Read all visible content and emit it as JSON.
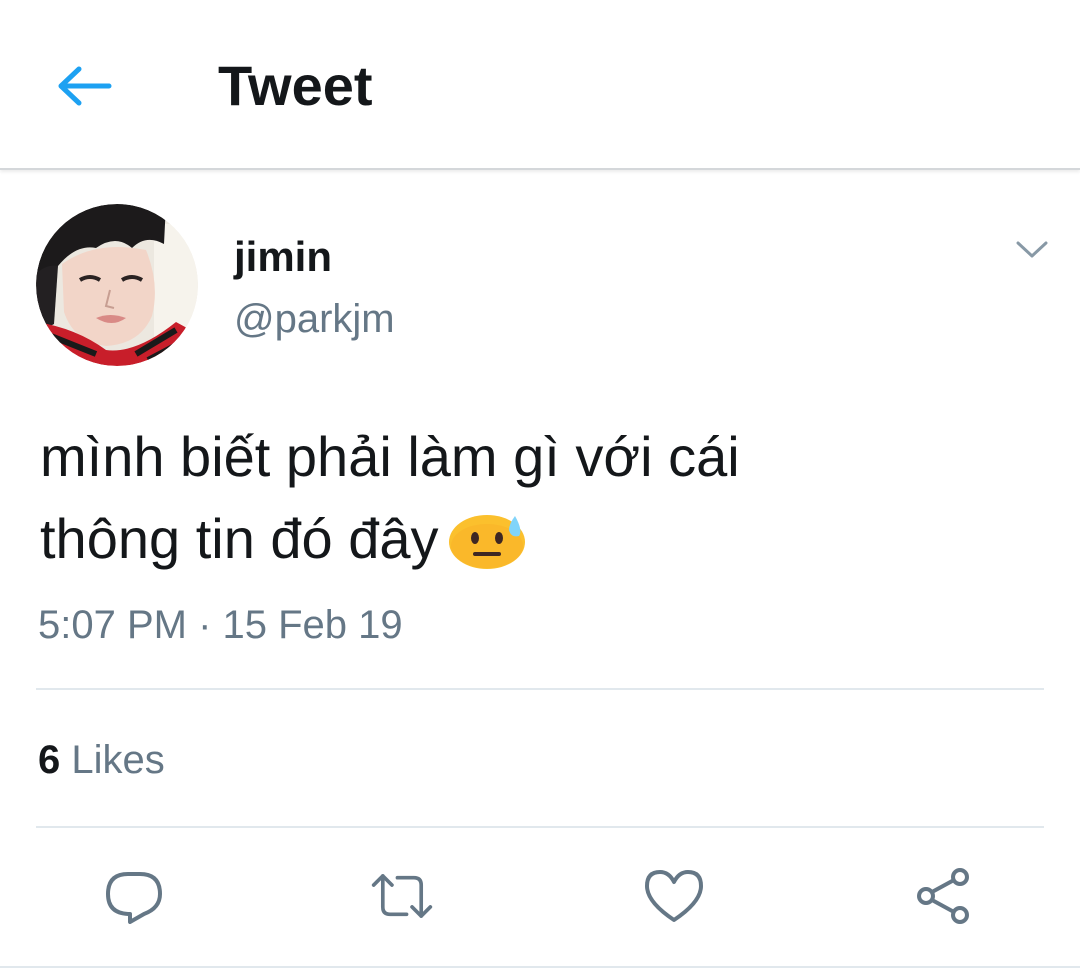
{
  "header": {
    "title": "Tweet",
    "back_icon": "arrow-left-icon",
    "accent_color": "#1da1f2"
  },
  "tweet": {
    "author": {
      "display_name": "jimin",
      "handle": "@parkjm",
      "avatar": "profile-photo"
    },
    "text_line1": "mình biết phải làm gì với cái",
    "text_line2": "thông tin đó đây",
    "emoji": "neutral-face-with-sweat-icon",
    "timestamp": "5:07 PM · 15 Feb 19",
    "likes": {
      "count": "6",
      "label": "Likes"
    }
  },
  "actions": [
    {
      "name": "reply",
      "icon": "reply-icon"
    },
    {
      "name": "retweet",
      "icon": "retweet-icon"
    },
    {
      "name": "like",
      "icon": "heart-icon"
    },
    {
      "name": "share",
      "icon": "share-icon"
    }
  ],
  "colors": {
    "text_primary": "#14171a",
    "text_secondary": "#657786",
    "divider": "#e1e8ed",
    "icon_gray": "#657786"
  }
}
